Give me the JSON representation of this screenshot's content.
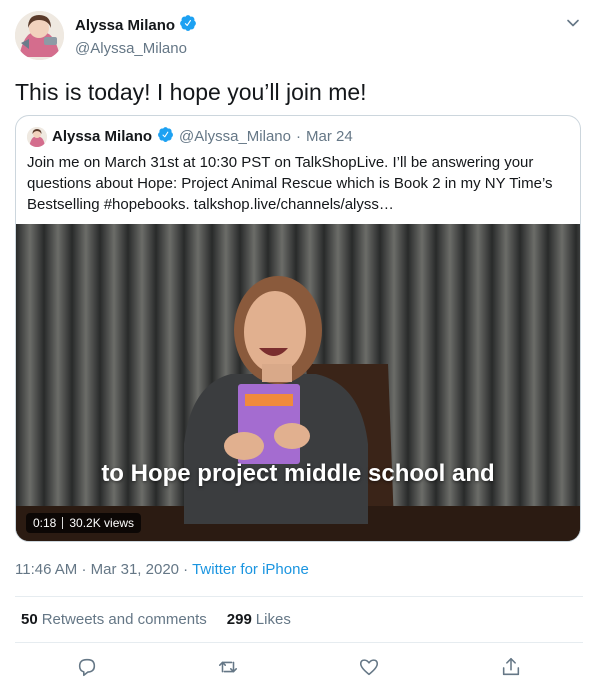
{
  "tweet": {
    "author_name": "Alyssa Milano",
    "author_handle": "@Alyssa_Milano",
    "text": "This is today! I hope you’ll join me!",
    "time": "11:46 AM",
    "date": "Mar 31, 2020",
    "separator_1": "·",
    "separator_2": "·",
    "source": "Twitter for iPhone"
  },
  "quoted": {
    "author_name": "Alyssa Milano",
    "author_handle": "@Alyssa_Milano",
    "dot": "·",
    "date": "Mar 24",
    "text": "Join me on March 31st at 10:30 PST on TalkShopLive. I’ll be answering your questions about Hope: Project Animal Rescue which is Book 2 in my NY Time’s Bestselling #hopebooks. talkshop.live/channels/alyss…",
    "video": {
      "caption": "to Hope project middle school and",
      "duration": "0:18",
      "views": "30.2K views"
    }
  },
  "stats": {
    "retweets_count": "50",
    "retweets_label": "Retweets and comments",
    "likes_count": "299",
    "likes_label": "Likes"
  },
  "icons": [
    "verified-badge-icon",
    "chevron-down-icon",
    "reply-icon",
    "retweet-icon",
    "like-icon",
    "share-icon"
  ],
  "colors": {
    "accent": "#1da1f2",
    "link": "#1b95e0",
    "secondary_text": "#657786",
    "border": "#ccd6dd"
  }
}
